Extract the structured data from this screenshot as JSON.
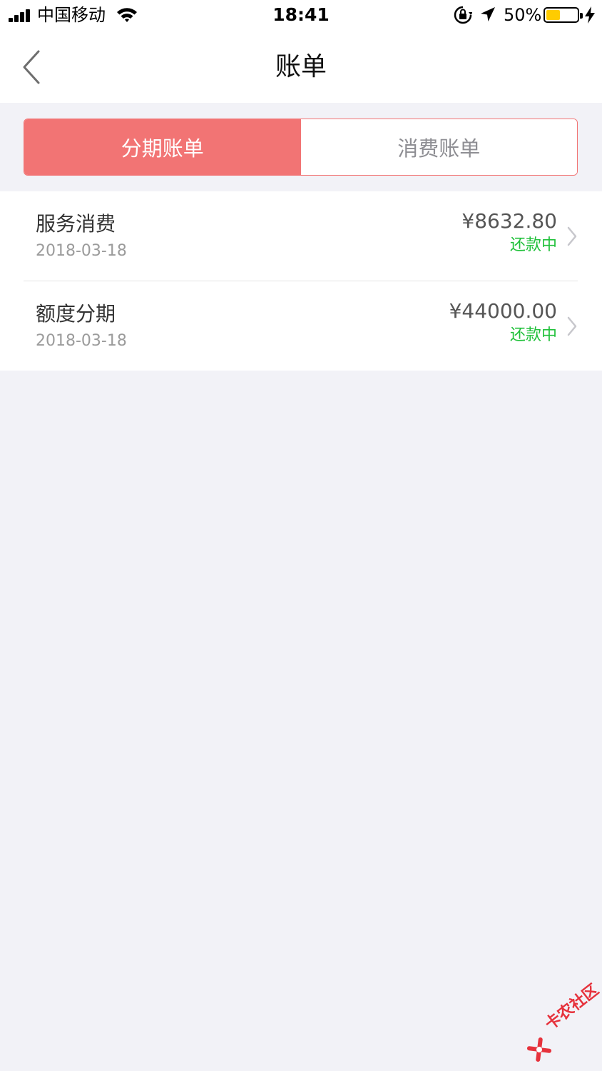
{
  "status_bar": {
    "carrier": "中国移动",
    "time": "18:41",
    "battery_percent": "50%",
    "battery_level": 0.5,
    "icons": [
      "signal-icon",
      "wifi-icon",
      "rotation-lock-icon",
      "location-arrow-icon",
      "battery-icon",
      "charging-bolt-icon"
    ]
  },
  "nav": {
    "title": "账单",
    "back_icon": "chevron-left-icon"
  },
  "tabs": [
    {
      "label": "分期账单",
      "active": true
    },
    {
      "label": "消费账单",
      "active": false
    }
  ],
  "bills": [
    {
      "name": "服务消费",
      "date": "2018-03-18",
      "amount": "¥8632.80",
      "status": "还款中"
    },
    {
      "name": "额度分期",
      "date": "2018-03-18",
      "amount": "¥44000.00",
      "status": "还款中"
    }
  ],
  "watermark": {
    "text": "卡农社区"
  },
  "colors": {
    "accent": "#f27474",
    "status_green": "#21c13b",
    "background": "#f2f2f7"
  }
}
